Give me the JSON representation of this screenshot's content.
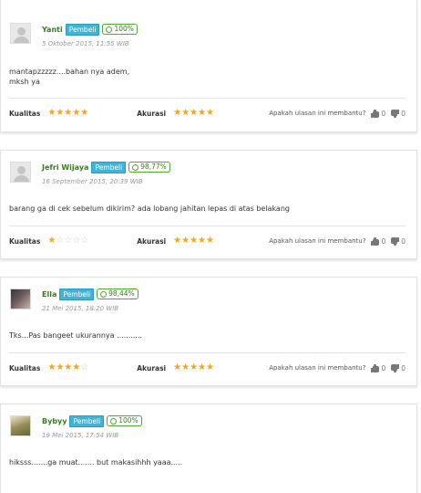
{
  "review_list": {
    "helpful_question": "Apakah ulasan ini membantu?",
    "quality_label": "Kualitas",
    "accuracy_label": "Akurasi",
    "badge_label": "Pembeli"
  },
  "reviews": [
    {
      "username": "Yanti",
      "rating_pct": "100%",
      "date": "5 Oktober 2015, 11:55 WIB",
      "text": "mantapzzzzz....bahan nya adem,\nmksh ya",
      "quality_stars": 5,
      "accuracy_stars": 5,
      "likes": "0",
      "dislikes": "0",
      "avatar": "placeholder"
    },
    {
      "username": "Jefri Wijaya",
      "rating_pct": "98,77%",
      "date": "16 September 2015, 20:39 WIB",
      "text": "barang ga di cek sebelum dikirim? ada lobang jahitan lepas di atas belakang",
      "quality_stars": 1,
      "accuracy_stars": 5,
      "likes": "0",
      "dislikes": "0",
      "avatar": "placeholder"
    },
    {
      "username": "Ella",
      "rating_pct": "98,44%",
      "date": "21 Mei 2015, 18:20 WIB",
      "text": "Tks...Pas bangeet ukurannya ...........",
      "quality_stars": 4,
      "accuracy_stars": 5,
      "likes": "0",
      "dislikes": "0",
      "avatar": "photo"
    },
    {
      "username": "Bybyy",
      "rating_pct": "100%",
      "date": "19 Mei 2015, 17:54 WIB",
      "text": "hiksss.......ga muat....... but makasihhh yaaa.....",
      "avatar": "photo"
    }
  ],
  "colors": {
    "star_filled": "#f4a51c",
    "star_empty": "#cfcfcf",
    "username": "#3a7a1f",
    "badge_bg": "#42b3d5"
  },
  "icons": [
    "smiley-icon",
    "thumbs-up-icon",
    "thumbs-down-icon",
    "star-icon",
    "avatar-placeholder-icon"
  ]
}
